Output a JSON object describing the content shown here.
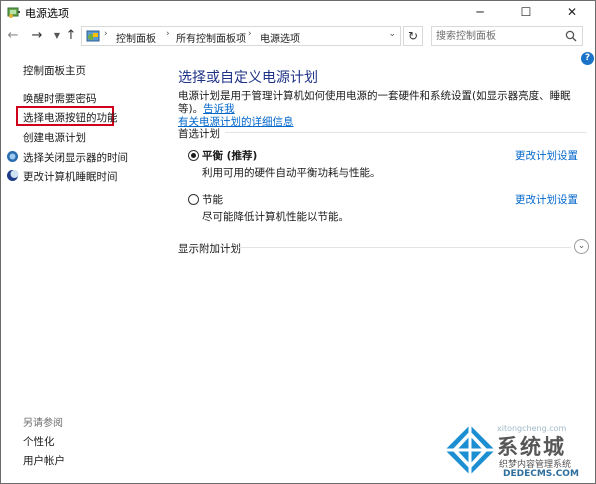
{
  "window": {
    "title": "电源选项",
    "minimize_glyph": "─",
    "maximize_glyph": "☐",
    "close_glyph": "✕"
  },
  "nav": {
    "back_glyph": "←",
    "forward_glyph": "→",
    "up_glyph": "↑",
    "breadcrumb": [
      "控制面板",
      "所有控制面板项",
      "电源选项"
    ],
    "refresh_glyph": "↻",
    "search_placeholder": "搜索控制面板"
  },
  "help_glyph": "?",
  "sidebar": {
    "items": [
      {
        "label": "控制面板主页"
      },
      {
        "label": "唤醒时需要密码"
      },
      {
        "label": "选择电源按钮的功能"
      },
      {
        "label": "创建电源计划"
      },
      {
        "label": "选择关闭显示器的时间"
      },
      {
        "label": "更改计算机睡眠时间"
      }
    ],
    "see_also": "另请参阅",
    "see_also_items": [
      {
        "label": "个性化"
      },
      {
        "label": "用户帐户"
      }
    ]
  },
  "main": {
    "heading": "选择或自定义电源计划",
    "desc_line1": "电源计划是用于管理计算机如何使用电源的一套硬件和系统设置(如显示器亮度、睡眠等)。",
    "desc_link_a": "告诉我",
    "desc_link_b": "有关电源计划的详细信息",
    "preferred_label": "首选计划",
    "plans": [
      {
        "name": "平衡 (推荐)",
        "desc": "利用可用的硬件自动平衡功耗与性能。",
        "link": "更改计划设置",
        "selected": true
      },
      {
        "name": "节能",
        "desc": "尽可能降低计算机性能以节能。",
        "link": "更改计划设置",
        "selected": false
      }
    ],
    "additional_label": "显示附加计划",
    "expand_glyph": "⌄"
  },
  "watermark": {
    "brand": "系统城",
    "url": "xitongcheng.com",
    "sub": "织梦内容管理系统",
    "dede": "DEDECMS.COM"
  },
  "colors": {
    "accent_link": "#0066cc",
    "heading": "#1e3287",
    "highlight_box": "#d0021b"
  }
}
